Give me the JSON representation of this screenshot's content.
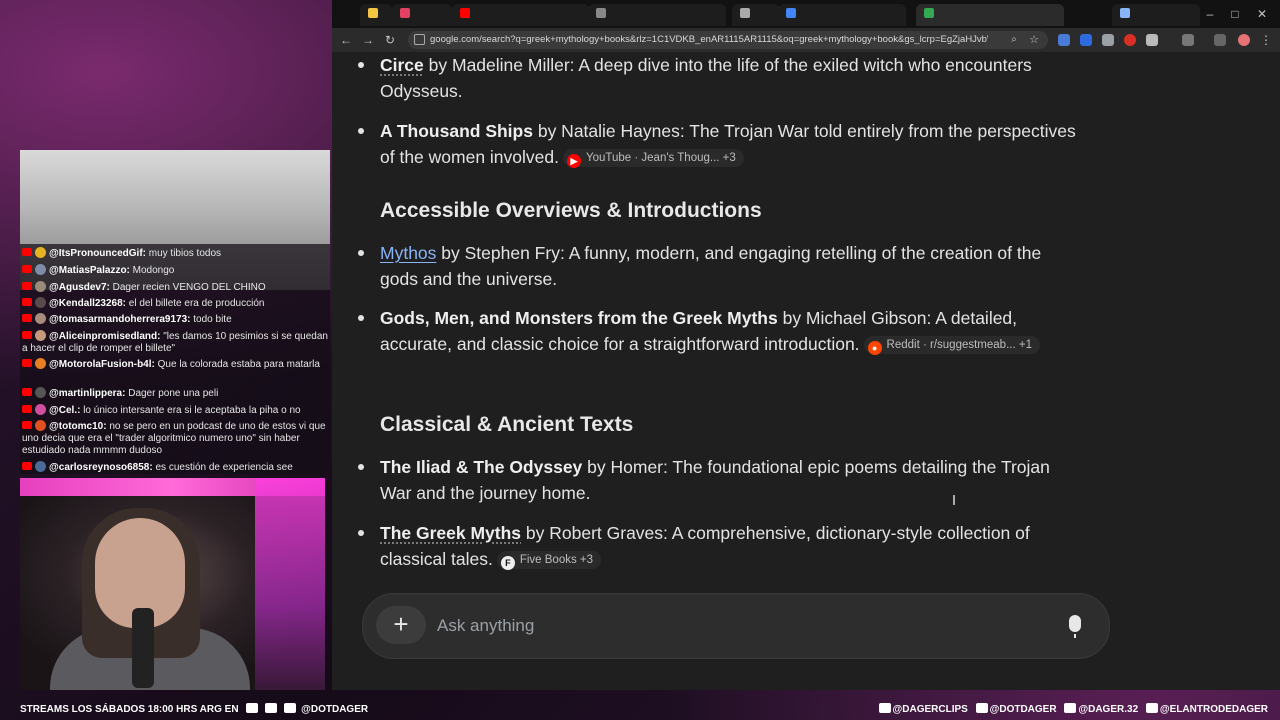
{
  "browser": {
    "url": "google.com/search?q=greek+mythology+books&rlz=1C1VDKB_enAR1115AR1115&oq=greek+mythology+book&gs_lcrp=EgZjaHJvbWUqBwgA..."
  },
  "results": {
    "top_items": [
      {
        "title": "Circe",
        "rest": " by Madeline Miller: A deep dive into the life of the exiled witch who encounters Odysseus."
      },
      {
        "title": "A Thousand Ships",
        "rest": " by Natalie Haynes: The Trojan War told entirely from the perspectives of the women involved.",
        "chip": "YouTube · Jean's Thoug... +3"
      }
    ],
    "section1": {
      "heading": "Accessible Overviews & Introductions",
      "items": [
        {
          "title": "Mythos",
          "rest": " by Stephen Fry: A funny, modern, and engaging retelling of the creation of the gods and the universe."
        },
        {
          "title": "Gods, Men, and Monsters from the Greek Myths",
          "rest": " by Michael Gibson: A detailed, accurate, and classic choice for a straightforward introduction.",
          "chip": "Reddit · r/suggestmeab... +1"
        }
      ]
    },
    "section2": {
      "heading": "Classical & Ancient Texts",
      "items": [
        {
          "title": "The Iliad & The Odyssey",
          "rest": " by Homer: The foundational epic poems detailing the Trojan War and the journey home."
        },
        {
          "title": "The Greek Myths",
          "rest": " by Robert Graves: A comprehensive, dictionary-style collection of classical tales.",
          "chip": "Five Books +3"
        }
      ]
    }
  },
  "ask": {
    "plus": "+",
    "placeholder": "Ask anything"
  },
  "chat": [
    {
      "user": "@ItsPronouncedGif:",
      "text": " muy tibios todos"
    },
    {
      "user": "@MatiasPalazzo:",
      "text": " Modongo"
    },
    {
      "user": "@Agusdev7:",
      "text": " Dager recien VENGO DEL CHINO"
    },
    {
      "user": "@Kendall23268:",
      "text": " el del billete era de producción"
    },
    {
      "user": "@tomasarmandoherrera9173:",
      "text": " todo bite"
    },
    {
      "user": "@Aliceinpromisedland:",
      "text": " \"les damos 10 pesimios si se quedan a hacer el clip de romper el billete\""
    },
    {
      "user": "@MotorolaFusion-b4l:",
      "text": " Que la colorada estaba para matarla"
    },
    {
      "user": "@martinlippera:",
      "text": " Dager pone una peli"
    },
    {
      "user": "@Cel.:",
      "text": " lo único intersante era si le aceptaba la piha o no"
    },
    {
      "user": "@totomc10:",
      "text": " no se pero en un podcast de uno de estos vi que uno decia que era el \"trader algoritmico numero uno\" sin haber estudiado nada mmmm dudoso"
    },
    {
      "user": "@carlosreynoso6858:",
      "text": " es cuestión de experiencia see"
    }
  ],
  "footer": {
    "left": "STREAMS  LOS SÁBADOS 18:00 HRS ARG EN",
    "left_handle": "@DOTDAGER",
    "right": [
      "@DAGERCLIPS",
      "@DOTDAGER",
      "@DAGER.32",
      "@ELANTRODEDAGER"
    ]
  }
}
